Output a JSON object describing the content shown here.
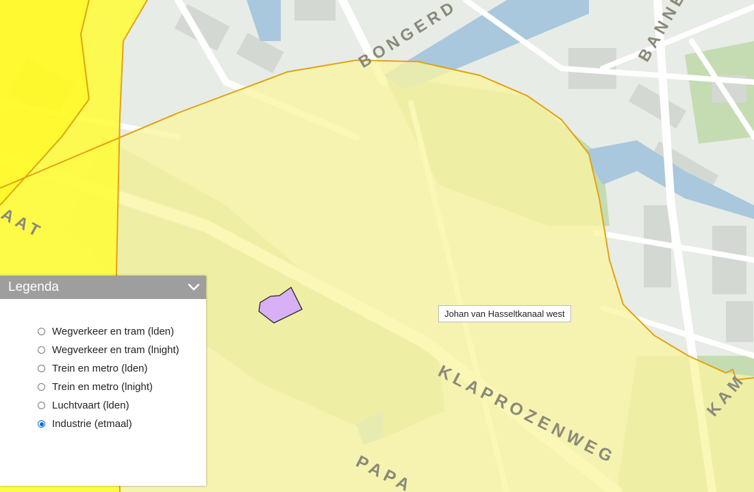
{
  "map": {
    "street_labels": [
      "BONGERD",
      "BANNE",
      "AAT",
      "KLAPROZENWEG",
      "PAPA",
      "KAM"
    ],
    "tooltip": "Johan van Hasseltkanaal west",
    "colors": {
      "base": "#e7ece6",
      "water": "#a9c8dd",
      "park": "#c5dcb3",
      "road": "#ffffff",
      "noise_zone_light": "#faf5a2",
      "noise_zone_strong": "#fffb36",
      "zone_outline": "#e3a20e",
      "selected_parcel": "#d8b0f5"
    }
  },
  "legend": {
    "title": "Legenda",
    "collapse_icon": "chevron-down-icon",
    "items": [
      {
        "label": "Wegverkeer en tram (lden)",
        "checked": false
      },
      {
        "label": "Wegverkeer en tram (lnight)",
        "checked": false
      },
      {
        "label": "Trein en metro (lden)",
        "checked": false
      },
      {
        "label": "Trein en metro (lnight)",
        "checked": false
      },
      {
        "label": "Luchtvaart (lden)",
        "checked": false
      },
      {
        "label": "Industrie (etmaal)",
        "checked": true
      }
    ]
  }
}
